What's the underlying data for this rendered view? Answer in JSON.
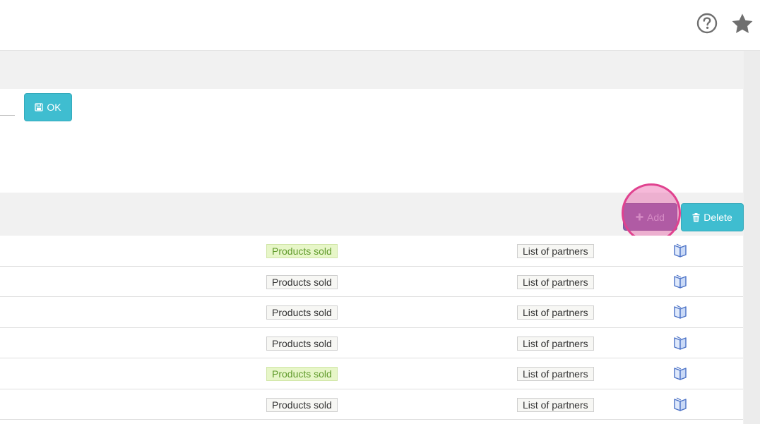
{
  "header": {
    "help_icon": "question-circle-icon",
    "favorite_icon": "star-icon"
  },
  "form": {
    "ok_label": "OK",
    "ok_icon": "save-icon"
  },
  "toolbar": {
    "add_label": "Add",
    "add_icon": "plus-icon",
    "delete_label": "Delete",
    "delete_icon": "trash-icon"
  },
  "rows": [
    {
      "products_label": "Products sold",
      "partners_label": "List of partners",
      "highlighted": true
    },
    {
      "products_label": "Products sold",
      "partners_label": "List of partners",
      "highlighted": false
    },
    {
      "products_label": "Products sold",
      "partners_label": "List of partners",
      "highlighted": false
    },
    {
      "products_label": "Products sold",
      "partners_label": "List of partners",
      "highlighted": false
    },
    {
      "products_label": "Products sold",
      "partners_label": "List of partners",
      "highlighted": true
    },
    {
      "products_label": "Products sold",
      "partners_label": "List of partners",
      "highlighted": false
    }
  ],
  "colors": {
    "accent": "#3fbdd0",
    "highlight_tag_bg": "#e7f6c8",
    "click_marker": "#e0428f"
  }
}
